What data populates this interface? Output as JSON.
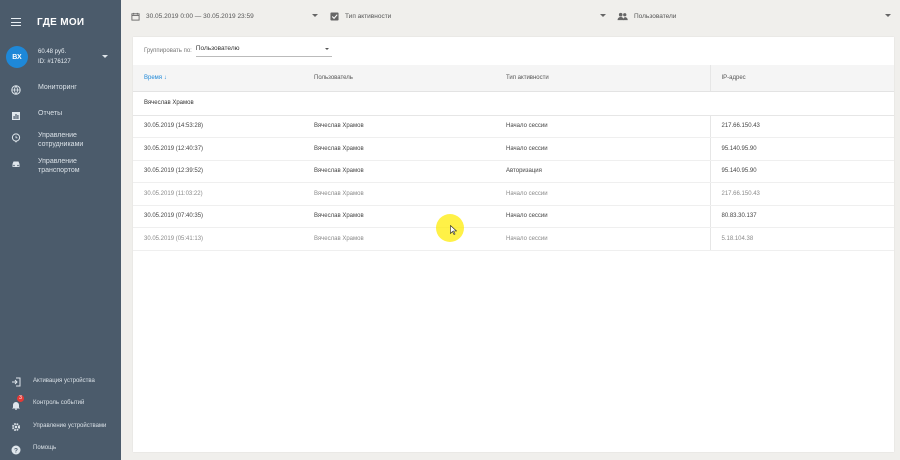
{
  "app": {
    "logo": "ГДЕ МОИ"
  },
  "account": {
    "initials": "ВХ",
    "balance": "60.48 руб.",
    "id_label": "ID: #176127"
  },
  "nav": {
    "items": [
      {
        "label": "Мониторинг",
        "icon": "globe-icon"
      },
      {
        "label": "Отчеты",
        "icon": "report-icon"
      },
      {
        "label": "Управление сотрудниками",
        "icon": "location-pin-icon"
      },
      {
        "label": "Управление транспортом",
        "icon": "car-icon"
      }
    ],
    "bottom": [
      {
        "label": "Активация устройства",
        "icon": "login-icon"
      },
      {
        "label": "Контроль событий",
        "icon": "bell-icon",
        "badge": "3"
      },
      {
        "label": "Управление устройствами",
        "icon": "gear-icon"
      },
      {
        "label": "Помощь",
        "icon": "help-icon"
      }
    ]
  },
  "filters": {
    "date_range": "30.05.2019 0:00 — 30.05.2019 23:59",
    "activity_type": "Тип активности",
    "users": "Пользователи"
  },
  "groupby": {
    "label": "Группировать по:",
    "value": "Пользователю"
  },
  "table": {
    "columns": [
      "Время",
      "Пользователь",
      "Тип активности",
      "IP-адрес"
    ],
    "sort_indicator": "↓",
    "group": "Вячеслав Храмов",
    "rows": [
      {
        "time": "30.05.2019 (14:53:28)",
        "user": "Вячеслав Храмов",
        "type": "Начало сессии",
        "ip": "217.66.150.43"
      },
      {
        "time": "30.05.2019 (12:40:37)",
        "user": "Вячеслав Храмов",
        "type": "Начало сессии",
        "ip": "95.140.95.90"
      },
      {
        "time": "30.05.2019 (12:39:52)",
        "user": "Вячеслав Храмов",
        "type": "Авторизация",
        "ip": "95.140.95.90"
      },
      {
        "time": "30.05.2019 (11:03:22)",
        "user": "Вячеслав Храмов",
        "type": "Начало сессии",
        "ip": "217.66.150.43"
      },
      {
        "time": "30.05.2019 (07:40:35)",
        "user": "Вячеслав Храмов",
        "type": "Начало сессии",
        "ip": "80.83.30.137"
      },
      {
        "time": "30.05.2019 (05:41:13)",
        "user": "Вячеслав Храмов",
        "type": "Начало сессии",
        "ip": "5.18.104.38"
      }
    ]
  },
  "colors": {
    "sidebar": "#4b5b6b",
    "accent": "#1e88d8",
    "badge": "#e53935",
    "cursor_highlight": "#ffec00"
  }
}
